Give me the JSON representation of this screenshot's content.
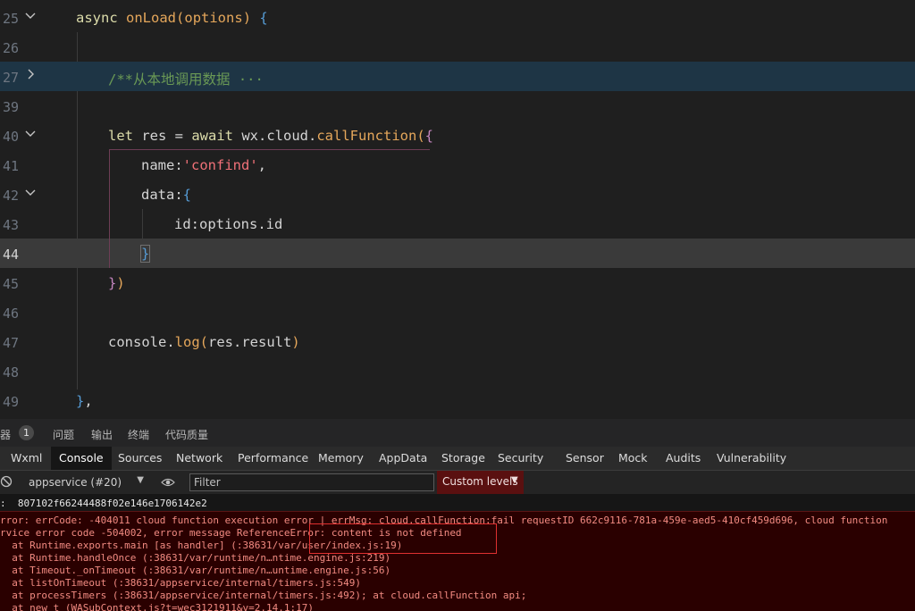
{
  "editor": {
    "lines": [
      {
        "num": "25",
        "text": "async onLoad(options) {"
      },
      {
        "num": "26",
        "text": ""
      },
      {
        "num": "27",
        "text": "/**从本地调用数据 ···"
      },
      {
        "num": "39",
        "text": ""
      },
      {
        "num": "40",
        "text": "let res = await wx.cloud.callFunction({"
      },
      {
        "num": "41",
        "text": "name:'confind',"
      },
      {
        "num": "42",
        "text": "data:{"
      },
      {
        "num": "43",
        "text": "id:options.id"
      },
      {
        "num": "44",
        "text": "}"
      },
      {
        "num": "45",
        "text": "})"
      },
      {
        "num": "46",
        "text": ""
      },
      {
        "num": "47",
        "text": "console.log(res.result)"
      },
      {
        "num": "48",
        "text": ""
      },
      {
        "num": "49",
        "text": "},"
      }
    ],
    "folded_comment": "/**从本地调用数据",
    "ellipsis": "···"
  },
  "panel_tabs": {
    "debugger_partial": "器",
    "badge": "1",
    "items": [
      "问题",
      "输出",
      "终端",
      "代码质量"
    ]
  },
  "devtools_tabs": [
    "Wxml",
    "Console",
    "Sources",
    "Network",
    "Performance",
    "Memory",
    "AppData",
    "Storage",
    "Security",
    "Sensor",
    "Mock",
    "Audits",
    "Vulnerability"
  ],
  "console_toolbar": {
    "context": "appservice (#20)",
    "filter_placeholder": "Filter",
    "levels": "Custom levels"
  },
  "console": {
    "info": ":  807102f66244488f02e146e1706142e2",
    "errors": [
      "rror: errCode: -404011 cloud function execution error | errMsg: cloud.callFunction:fail requestID 662c9116-781a-459e-aed5-410cf459d696, cloud function",
      "rvice error code -504002, error message ReferenceError: content is not defined",
      "  at Runtime.exports.main [as handler] (:38631/var/user/index.js:19)",
      "  at Runtime.handleOnce (:38631/var/runtime/n…ntime.engine.js:219)",
      "  at Timeout._onTimeout (:38631/var/runtime/n…untime.engine.js:56)",
      "  at listOnTimeout (:38631/appservice/internal/timers.js:549)",
      "  at processTimers (:38631/appservice/internal/timers.js:492); at cloud.callFunction api;",
      "  at new t (WASubContext.js?t=wec3121911&v=2.14.1:17)"
    ]
  },
  "colors": {
    "editor_bg": "#1f1f1f",
    "error_bg": "#2a0000",
    "error_text": "#f28b82",
    "levels_bg": "#5a1010"
  }
}
